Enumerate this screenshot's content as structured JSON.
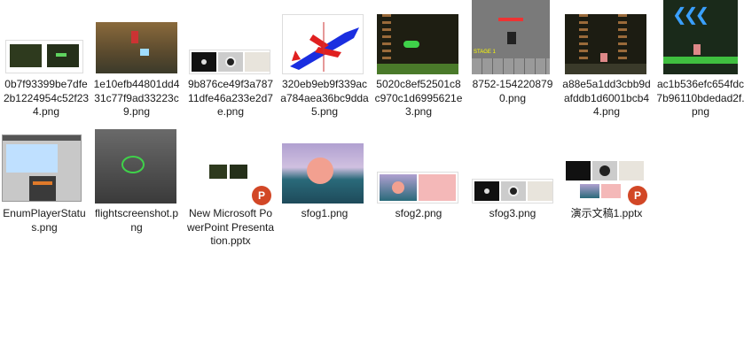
{
  "files": [
    {
      "name": "0b7f93399be7dfe2b1224954c52f234.png",
      "thumb": "two-game-screens"
    },
    {
      "name": "1e10efb44801dd431c77f9ad33223c9.png",
      "thumb": "cave-scene"
    },
    {
      "name": "9b876ce49f3a78711dfe46a233e2d7e.png",
      "thumb": "three-panel-strip"
    },
    {
      "name": "320eb9eb9f339aca784aea36bc9dda5.png",
      "thumb": "airplane-diagram"
    },
    {
      "name": "5020c8ef52501c8c970c1d6995621e3.png",
      "thumb": "ladder-level"
    },
    {
      "name": "8752-1542208790.png",
      "thumb": "stage-map"
    },
    {
      "name": "a88e5a1dd3cbb9dafddb1d6001bcb44.png",
      "thumb": "ladder-level-2"
    },
    {
      "name": "ac1b536efc654fdc7b96110bdedad2f.png",
      "thumb": "arrow-level"
    },
    {
      "name": "EnumPlayerStatus.png",
      "thumb": "unity-editor"
    },
    {
      "name": "flightscreenshot.png",
      "thumb": "flight-terrain"
    },
    {
      "name": "New Microsoft PowerPoint Presentation.pptx",
      "thumb": "pptx-small"
    },
    {
      "name": "sfog1.png",
      "thumb": "fog-sea"
    },
    {
      "name": "sfog2.png",
      "thumb": "fog-pair"
    },
    {
      "name": "sfog3.png",
      "thumb": "three-panel-strip"
    },
    {
      "name": "演示文稿1.pptx",
      "thumb": "pptx-collage"
    }
  ],
  "thumb_labels": {
    "stage_text": "STAGE 1"
  },
  "badge_letter": "P"
}
